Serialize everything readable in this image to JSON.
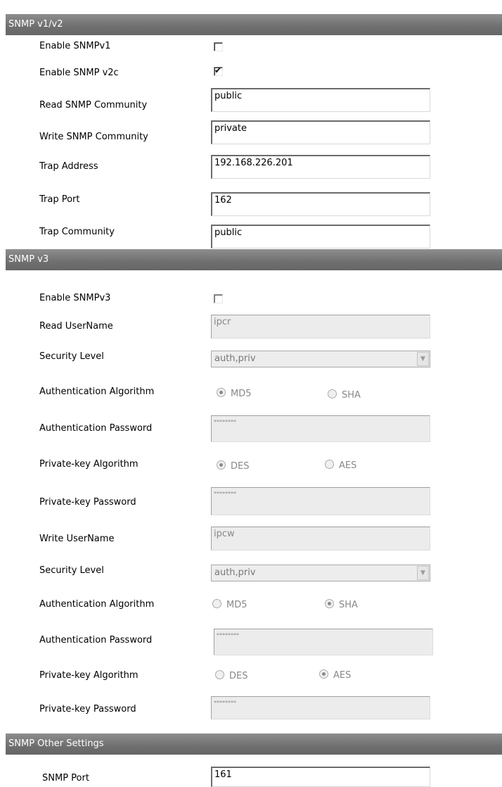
{
  "sections": {
    "v1v2_title": "SNMP v1/v2",
    "v3_title": "SNMP v3",
    "other_title": "SNMP Other Settings"
  },
  "v1v2": {
    "enable_v1_label": "Enable SNMPv1",
    "enable_v1_checked": false,
    "enable_v2c_label": "Enable SNMP v2c",
    "enable_v2c_checked": true,
    "read_community_label": "Read SNMP Community",
    "read_community_value": "public",
    "write_community_label": "Write SNMP Community",
    "write_community_value": "private",
    "trap_address_label": "Trap Address",
    "trap_address_value": "192.168.226.201",
    "trap_port_label": "Trap Port",
    "trap_port_value": "162",
    "trap_community_label": "Trap Community",
    "trap_community_value": "public"
  },
  "v3": {
    "enable_v3_label": "Enable SNMPv3",
    "enable_v3_checked": false,
    "read_username_label": "Read UserName",
    "read_username_value": "ipcr",
    "read_security_level_label": "Security Level",
    "read_security_level_value": "auth,priv",
    "read_auth_algo_label": "Authentication Algorithm",
    "read_auth_md5": "MD5",
    "read_auth_sha": "SHA",
    "read_auth_selected": "MD5",
    "read_auth_password_label": "Authentication Password",
    "read_auth_password_value": "********",
    "read_priv_algo_label": "Private-key Algorithm",
    "read_priv_des": "DES",
    "read_priv_aes": "AES",
    "read_priv_selected": "DES",
    "read_priv_password_label": "Private-key Password",
    "read_priv_password_value": "********",
    "write_username_label": "Write UserName",
    "write_username_value": "ipcw",
    "write_security_level_label": "Security Level",
    "write_security_level_value": "auth,priv",
    "write_auth_algo_label": "Authentication Algorithm",
    "write_auth_md5": "MD5",
    "write_auth_sha": "SHA",
    "write_auth_selected": "SHA",
    "write_auth_password_label": "Authentication Password",
    "write_auth_password_value": "********",
    "write_priv_algo_label": "Private-key Algorithm",
    "write_priv_des": "DES",
    "write_priv_aes": "AES",
    "write_priv_selected": "AES",
    "write_priv_password_label": "Private-key Password",
    "write_priv_password_value": "********"
  },
  "other": {
    "snmp_port_label": "SNMP Port",
    "snmp_port_value": "161"
  },
  "icons": {
    "checkmark": "✔",
    "dropdown_arrow": "▼"
  }
}
